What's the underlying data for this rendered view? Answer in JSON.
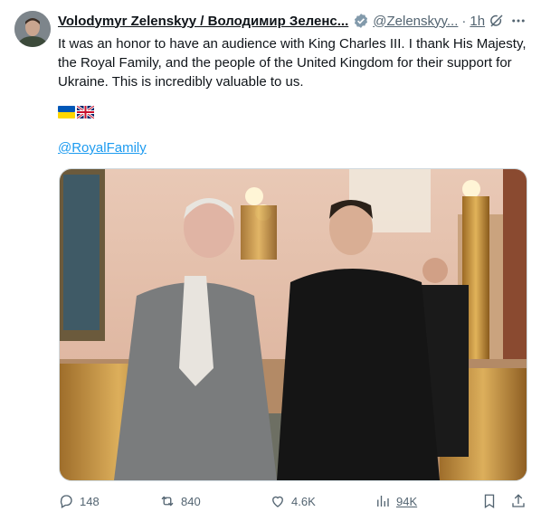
{
  "tweet": {
    "author_name": "Volodymyr Zelenskyy / Володимир Зеленс...",
    "handle": "@Zelenskyy...",
    "separator": "·",
    "time": "1h",
    "body": "It was an honor to have an audience with King Charles III. I thank His Majesty, the Royal Family, and the people of the United Kingdom for their support for Ukraine. This is incredibly valuable to us.",
    "mention": "@RoyalFamily"
  },
  "actions": {
    "replies": "148",
    "reposts": "840",
    "likes": "4.6K",
    "views": "94K"
  },
  "colors": {
    "accent": "#1d9bf0",
    "secondary_text": "#536471",
    "verified_badge": "#829aab",
    "primary_text": "#0f1419"
  },
  "icons": [
    "verified-icon",
    "grok-icon",
    "more-icon",
    "ukraine-flag-icon",
    "uk-flag-icon",
    "reply-icon",
    "repost-icon",
    "like-icon",
    "views-icon",
    "bookmark-icon",
    "share-icon"
  ]
}
